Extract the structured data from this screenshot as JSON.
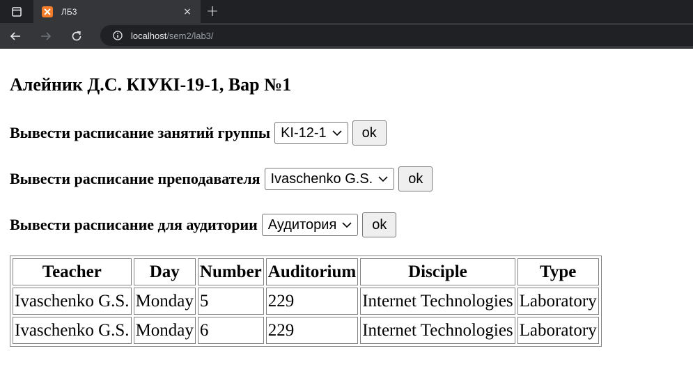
{
  "browser": {
    "tab_title": "ЛБ3",
    "tab_close": "×",
    "new_tab": "+",
    "url_host": "localhost",
    "url_path": "/sem2/lab3/"
  },
  "page": {
    "heading": "Алейник Д.С. КІУКІ-19-1, Вар №1",
    "forms": [
      {
        "label": "Вывести расписание занятий группы",
        "select_value": "KI-12-1",
        "button": "ok"
      },
      {
        "label": "Вывести расписание преподавателя",
        "select_value": "Ivaschenko G.S.",
        "button": "ok"
      },
      {
        "label": "Вывести расписание для аудитории",
        "select_value": "Аудитория",
        "button": "ok"
      }
    ]
  },
  "table": {
    "headers": [
      "Teacher",
      "Day",
      "Number",
      "Auditorium",
      "Disciple",
      "Type"
    ],
    "rows": [
      [
        "Ivaschenko G.S.",
        "Monday",
        "5",
        "229",
        "Internet Technologies",
        "Laboratory"
      ],
      [
        "Ivaschenko G.S.",
        "Monday",
        "6",
        "229",
        "Internet Technologies",
        "Laboratory"
      ]
    ]
  },
  "colors": {
    "tabstrip_bg": "#202124",
    "toolbar_bg": "#35363a",
    "favicon": "#f37c2a"
  }
}
